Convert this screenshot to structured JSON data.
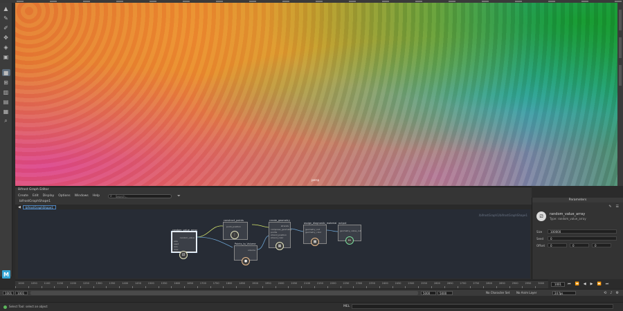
{
  "graph_editor": {
    "title": "Bifrost Graph Editor",
    "menu": [
      "Create",
      "Edit",
      "Display",
      "Options",
      "Windows",
      "Help"
    ],
    "search_placeholder": "Search...",
    "graph_path": "bifrostGraphShape1",
    "tab_label": "bifrostGraphShape1",
    "canvas_path": "/bifrostGraph1/bifrostGraphShape1"
  },
  "nodes": {
    "random_value_array": {
      "title": "random_value_array",
      "ports": [
        "random_value",
        "size",
        "seed",
        "min",
        "max"
      ]
    },
    "construct_points": {
      "title": "construct_points",
      "ports": [
        "point_position"
      ]
    },
    "create_geometry": {
      "title": "create_geometry",
      "ports": [
        "strands",
        "compress_geometry",
        "points",
        "strand_position",
        "strand_color"
      ]
    },
    "assign_diagnostic_material": {
      "title": "assign_diagnostic_material",
      "ports": [
        "geometry_out",
        "geometry_color"
      ]
    },
    "output": {
      "title": "output",
      "ports": [
        "geometry_value_out"
      ]
    },
    "points_to_volume": {
      "title": "Points_to_Volume",
      "ports": [
        "volume"
      ]
    }
  },
  "parameters": {
    "panel_title": "Parameters",
    "node_name": "random_value_array",
    "node_type": "Type: random_value_array",
    "size_label": "Size",
    "size_value": "100000",
    "seed_label": "Seed",
    "seed_value": "0",
    "offset_label": "Offset",
    "offset_values": [
      "0",
      "0",
      "0"
    ]
  },
  "timeline": {
    "ticks": [
      "1000",
      "1050",
      "1100",
      "1150",
      "1200",
      "1250",
      "1300",
      "1350",
      "1400",
      "1450",
      "1500",
      "1550",
      "1600",
      "1650",
      "1700",
      "1750",
      "1800",
      "1850",
      "1900",
      "1950",
      "2000",
      "2050",
      "2100",
      "2150",
      "2200",
      "2250",
      "2300",
      "2350",
      "2400",
      "2450",
      "2500",
      "2550",
      "2600",
      "2650",
      "2700",
      "2750",
      "2800",
      "2850",
      "2900",
      "2950",
      "3000"
    ],
    "current_frame": "1001"
  },
  "range": {
    "start": "1001",
    "inner_start": "1001",
    "inner_end": "5000",
    "end": "5000",
    "character_set": "No Character Set",
    "anim_layer": "No Anim Layer",
    "fps": "24 fps"
  },
  "command_line": {
    "help_text": "Select Tool: select an object",
    "mel_label": "MEL"
  }
}
